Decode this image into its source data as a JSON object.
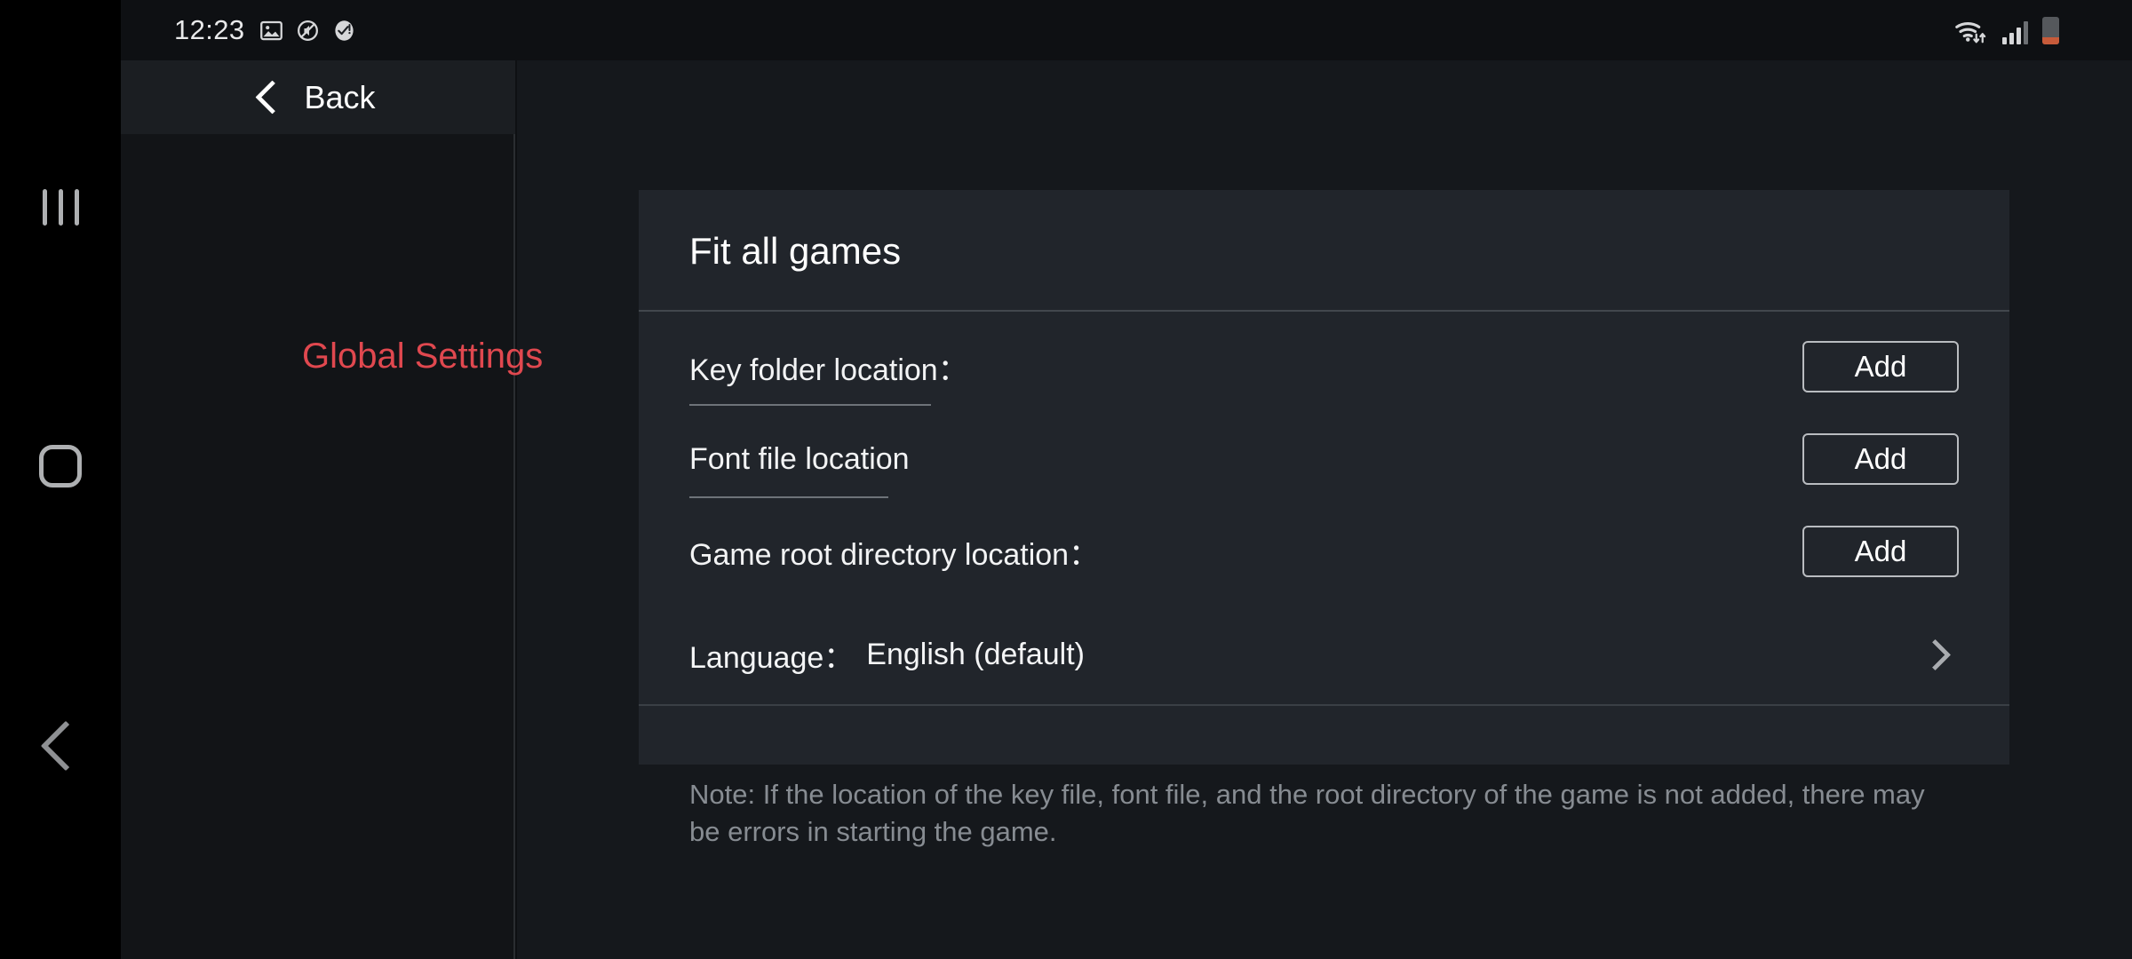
{
  "status_bar": {
    "time": "12:23",
    "left_icons": [
      "image-icon",
      "no-sound-icon",
      "check-alert-icon"
    ],
    "right_icons": [
      "wifi-transfer-icon",
      "cellular-signal-icon",
      "battery-low-icon"
    ]
  },
  "nav_bar": {
    "recents_label": "recents-icon",
    "home_label": "home-icon",
    "back_label": "back-icon"
  },
  "header": {
    "back_label": "Back"
  },
  "sidebar": {
    "items": [
      {
        "label": "Global Settings",
        "selected": true
      }
    ]
  },
  "main": {
    "fit_card": {
      "title": "Fit all games",
      "rows": [
        {
          "label": "Key folder location：",
          "value": "",
          "button": "Add"
        },
        {
          "label": "Font file location",
          "value": "",
          "button": "Add"
        },
        {
          "label": "Game root directory location：",
          "value": "",
          "button": "Add"
        }
      ]
    },
    "note": "Note: If the location of the key file, font file, and the root directory of the game is not added, there may be errors in starting the game.",
    "language_card": {
      "label": "Language：",
      "value": "English (default)",
      "chevron": "chevron-right-icon"
    }
  },
  "colors": {
    "accent": "#e0484f",
    "card_bg": "#21252b",
    "page_bg": "#15181c",
    "sidebar_bg": "#121417",
    "battery_low": "#c75b3a"
  }
}
